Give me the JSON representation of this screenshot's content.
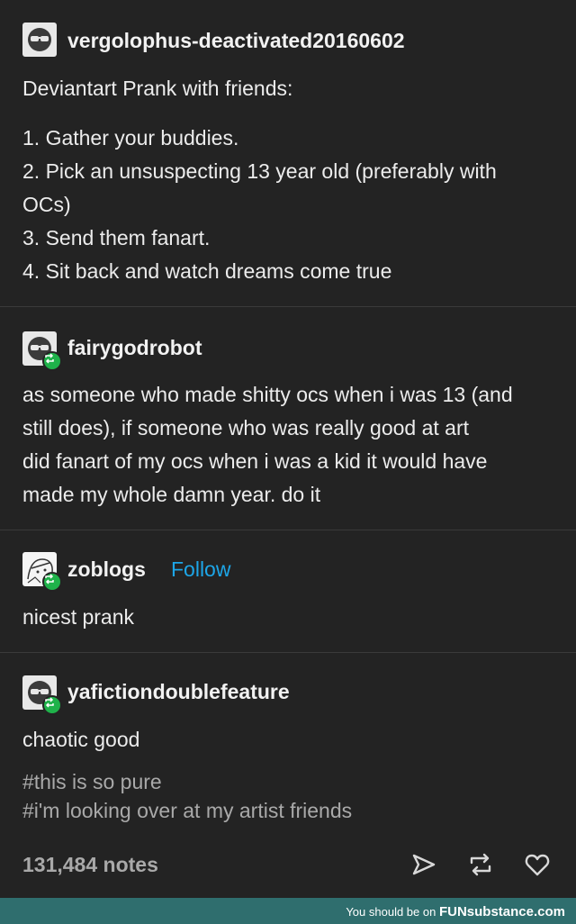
{
  "posts": [
    {
      "username": "vergolophus-deactivated20160602",
      "lines": [
        "Deviantart Prank with friends:",
        "",
        "1. Gather your buddies.",
        "2. Pick an unsuspecting 13 year old (preferably with",
        "OCs)",
        "3. Send them fanart.",
        "4. Sit back and watch dreams come true"
      ]
    },
    {
      "username": "fairygodrobot",
      "lines": [
        "as someone who made shitty ocs when i was 13 (and",
        "still does), if someone who was really good at art",
        "did fanart of my ocs when i was a kid it would have",
        "made my whole damn year. do it"
      ]
    },
    {
      "username": "zoblogs",
      "follow_label": "Follow",
      "lines": [
        "nicest prank"
      ]
    },
    {
      "username": "yafictiondoublefeature",
      "lines": [
        "chaotic good"
      ],
      "tags": [
        "#this is so pure",
        "#i'm looking over at my artist friends"
      ]
    }
  ],
  "notes": "131,484 notes",
  "actions": {
    "share_icon": "send-icon",
    "reblog_icon": "reblog-icon",
    "like_icon": "heart-icon"
  },
  "footer": {
    "prefix": "You should be on ",
    "brand": "FUNsubstance.com"
  },
  "colors": {
    "background": "#232323",
    "follow": "#1da6e8",
    "reblog_badge": "#1fb24a",
    "footer": "#2f6e6e"
  }
}
